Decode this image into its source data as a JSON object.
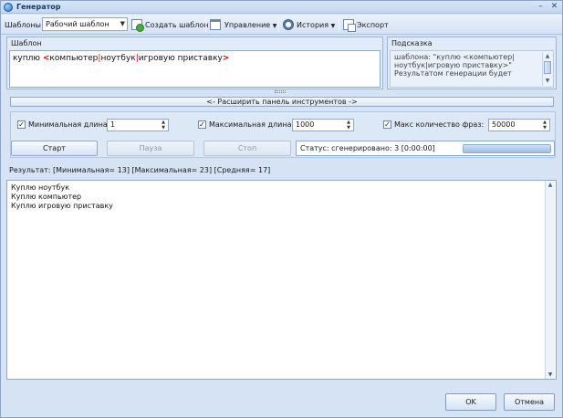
{
  "window": {
    "title": "Генератор"
  },
  "toolbar": {
    "templates_label": "Шаблоны",
    "template_select_value": "Рабочий шаблон",
    "create_template": "Создать шаблон",
    "manage": "Управление",
    "history": "История",
    "export": "Экспорт"
  },
  "template_panel": {
    "label": "Шаблон",
    "word": "куплю",
    "open_bracket": "<",
    "option1": "компьютер",
    "separator": "|",
    "option2": "ноутбук",
    "option3": "игровую приставку",
    "close_bracket": ">"
  },
  "hint_panel": {
    "label": "Подсказка",
    "text": "шаблона: \"куплю <компьютер|ноутбук|игровую приставку>\" Результатом генерации будет"
  },
  "tools": {
    "expand_label": "<- Расширить панель инструментов ->",
    "min_length_label": "Минимальная длина:",
    "min_length_value": "1",
    "max_length_label": "Максимальная длина:",
    "max_length_value": "1000",
    "max_phrases_label": "Макс количество фраз:",
    "max_phrases_value": "50000",
    "start": "Старт",
    "pause": "Пауза",
    "stop": "Стоп",
    "status": "Статус: сгенерировано: 3  [0:00:00]",
    "progress": 1.0
  },
  "result": {
    "summary": "Результат: [Минимальная= 13] [Максимальная= 23] [Средняя= 17]",
    "lines": [
      "Куплю ноутбук",
      "Куплю компьютер",
      "Куплю игровую приставку"
    ]
  },
  "footer": {
    "ok": "OK",
    "cancel": "Отмена"
  }
}
